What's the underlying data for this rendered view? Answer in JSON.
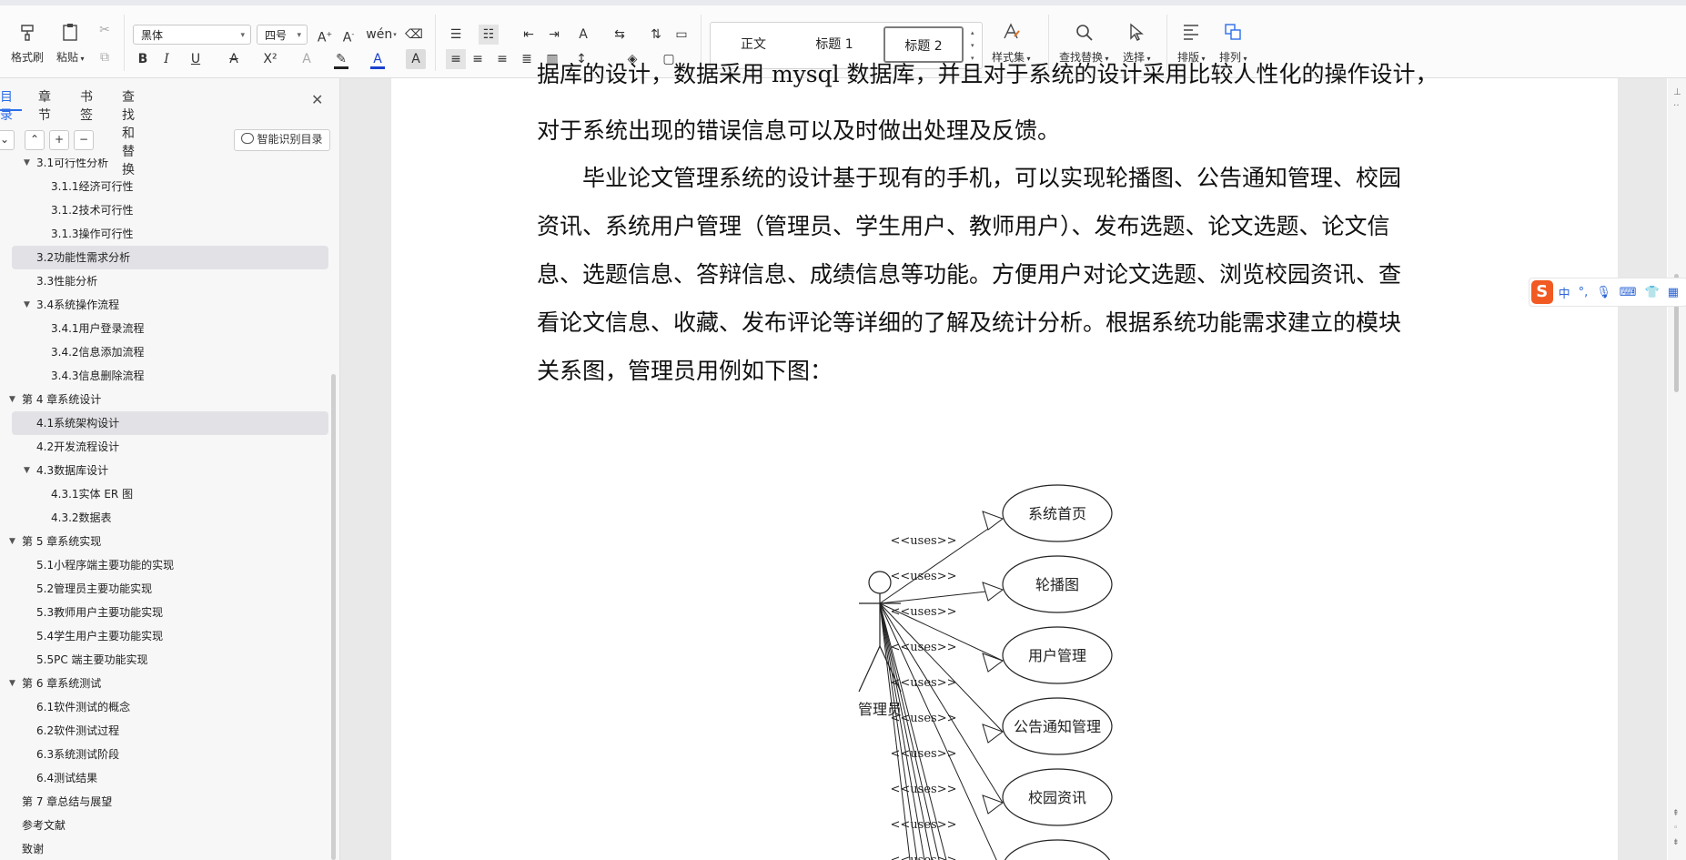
{
  "ribbon": {
    "format_painter": "格式刷",
    "paste": "粘贴",
    "font_name": "黑体",
    "font_size": "四号",
    "bold": "B",
    "italic": "I",
    "underline": "U",
    "strikethrough": "A",
    "superscript": "X²",
    "styles": {
      "normal": "正文",
      "heading1": "标题 1",
      "heading2": "标题 2",
      "selected": "标题 2"
    },
    "style_set": "样式集",
    "find_replace": "查找替换",
    "select": "选择",
    "layout": "排版",
    "arrange": "排列"
  },
  "sidebar": {
    "tabs": [
      "目录",
      "章节",
      "书签",
      "查找和替换"
    ],
    "active_tab": "目录",
    "smart_toc": "智能识别目录",
    "toc": [
      {
        "label": "3.1可行性分析",
        "level": 2,
        "toggle": "expanded",
        "selected": false
      },
      {
        "label": "3.1.1经济可行性",
        "level": 3,
        "toggle": "none",
        "selected": false
      },
      {
        "label": "3.1.2技术可行性",
        "level": 3,
        "toggle": "none",
        "selected": false
      },
      {
        "label": "3.1.3操作可行性",
        "level": 3,
        "toggle": "none",
        "selected": false
      },
      {
        "label": "3.2功能性需求分析",
        "level": 2,
        "toggle": "none",
        "selected": true
      },
      {
        "label": "3.3性能分析",
        "level": 2,
        "toggle": "none",
        "selected": false
      },
      {
        "label": "3.4系统操作流程",
        "level": 2,
        "toggle": "expanded",
        "selected": false
      },
      {
        "label": "3.4.1用户登录流程",
        "level": 3,
        "toggle": "none",
        "selected": false
      },
      {
        "label": "3.4.2信息添加流程",
        "level": 3,
        "toggle": "none",
        "selected": false
      },
      {
        "label": "3.4.3信息删除流程",
        "level": 3,
        "toggle": "none",
        "selected": false
      },
      {
        "label": "第 4 章系统设计",
        "level": 1,
        "toggle": "expanded",
        "selected": false
      },
      {
        "label": "4.1系统架构设计",
        "level": 2,
        "toggle": "none",
        "selected": true
      },
      {
        "label": "4.2开发流程设计",
        "level": 2,
        "toggle": "none",
        "selected": false
      },
      {
        "label": "4.3数据库设计",
        "level": 2,
        "toggle": "expanded",
        "selected": false
      },
      {
        "label": "4.3.1实体 ER 图",
        "level": 3,
        "toggle": "none",
        "selected": false
      },
      {
        "label": "4.3.2数据表",
        "level": 3,
        "toggle": "none",
        "selected": false
      },
      {
        "label": "第 5 章系统实现",
        "level": 1,
        "toggle": "expanded",
        "selected": false
      },
      {
        "label": "5.1小程序端主要功能的实现",
        "level": 2,
        "toggle": "none",
        "selected": false
      },
      {
        "label": "5.2管理员主要功能实现",
        "level": 2,
        "toggle": "none",
        "selected": false
      },
      {
        "label": "5.3教师用户主要功能实现",
        "level": 2,
        "toggle": "none",
        "selected": false
      },
      {
        "label": "5.4学生用户主要功能实现",
        "level": 2,
        "toggle": "none",
        "selected": false
      },
      {
        "label": "5.5PC 端主要功能实现",
        "level": 2,
        "toggle": "none",
        "selected": false
      },
      {
        "label": "第 6 章系统测试",
        "level": 1,
        "toggle": "expanded",
        "selected": false
      },
      {
        "label": "6.1软件测试的概念",
        "level": 2,
        "toggle": "none",
        "selected": false
      },
      {
        "label": "6.2软件测试过程",
        "level": 2,
        "toggle": "none",
        "selected": false
      },
      {
        "label": "6.3系统测试阶段",
        "level": 2,
        "toggle": "none",
        "selected": false
      },
      {
        "label": "6.4测试结果",
        "level": 2,
        "toggle": "none",
        "selected": false
      },
      {
        "label": "第 7 章总结与展望",
        "level": 1,
        "toggle": "none",
        "selected": false
      },
      {
        "label": "参考文献",
        "level": 1,
        "toggle": "none",
        "selected": false
      },
      {
        "label": "致谢",
        "level": 1,
        "toggle": "none",
        "selected": false
      }
    ]
  },
  "document": {
    "lines": [
      "据库的设计，数据采用 mysql 数据库，并且对于系统的设计采用比较人性化的操作设计，",
      "对于系统出现的错误信息可以及时做出处理及反馈。",
      "毕业论文管理系统的设计基于现有的手机，可以实现轮播图、公告通知管理、校园",
      "资讯、系统用户管理（管理员、学生用户、教师用户）、发布选题、论文选题、论文信",
      "息、选题信息、答辩信息、成绩信息等功能。方便用户对论文选题、浏览校园资讯、查",
      "看论文信息、收藏、发布评论等详细的了解及统计分析。根据系统功能需求建立的模块",
      "关系图，管理员用例如下图："
    ],
    "diagram": {
      "actor": "管理员",
      "uses_label": "<<uses>>",
      "use_cases": [
        "系统首页",
        "轮播图",
        "用户管理",
        "公告通知管理",
        "校园资讯",
        ""
      ]
    }
  },
  "ime": {
    "logo": "S",
    "mode": "中"
  }
}
